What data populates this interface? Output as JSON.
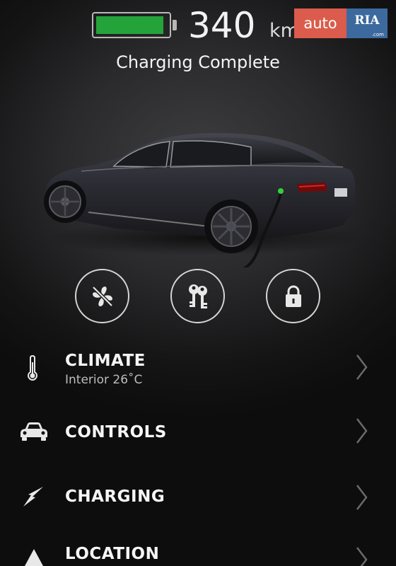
{
  "battery": {
    "level": 0.95,
    "color": "#24a33a"
  },
  "range": {
    "value": "340",
    "unit": "km"
  },
  "status": "Charging Complete",
  "watermark": {
    "auto": "auto",
    "ria": "RIA",
    "domain": ".com"
  },
  "controls": [
    {
      "name": "fan-icon"
    },
    {
      "name": "keys-icon"
    },
    {
      "name": "lock-icon"
    }
  ],
  "menu": {
    "climate": {
      "title": "CLIMATE",
      "subtitle": "Interior 26˚C"
    },
    "controls": {
      "title": "CONTROLS"
    },
    "charging": {
      "title": "CHARGING"
    },
    "location": {
      "title": "LOCATION"
    }
  }
}
